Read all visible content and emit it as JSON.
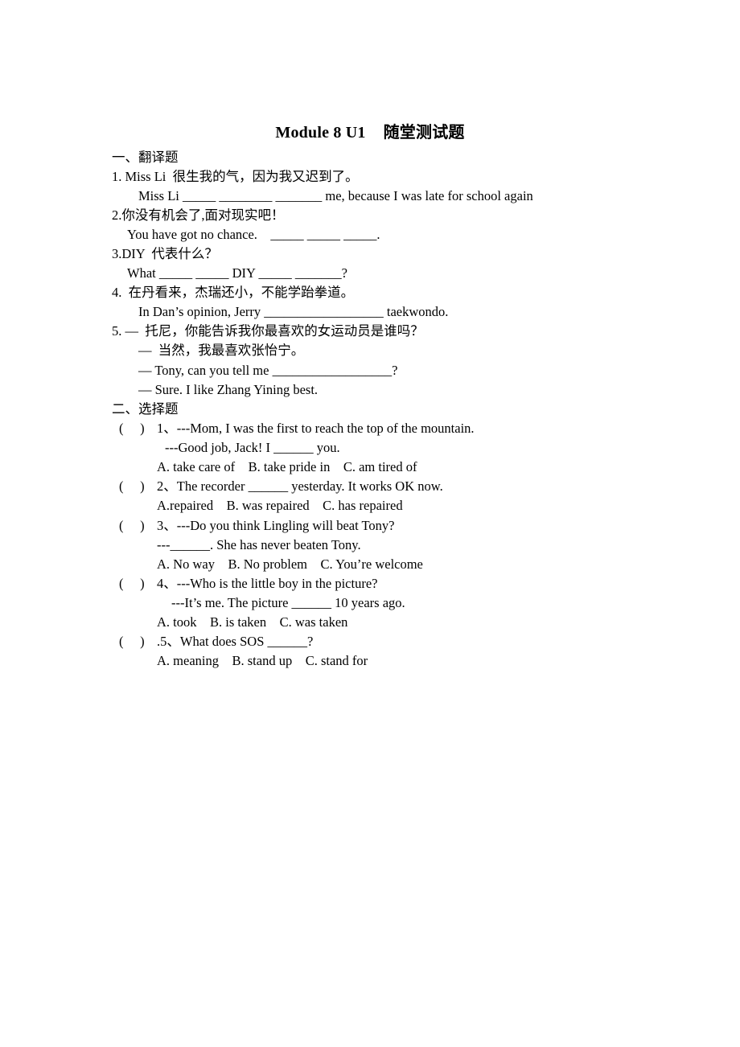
{
  "title": {
    "en": "Module 8 U1",
    "cn": "随堂测试题"
  },
  "section1": {
    "heading": "一、翻译题",
    "questions": [
      {
        "prompt": "1. Miss Li  很生我的气，因为我又迟到了。",
        "answer_lines": [
          "Miss Li _____ ________ _______ me, because I was late for school again"
        ]
      },
      {
        "prompt": "2.你没有机会了,面对现实吧！",
        "answer_lines": [
          "You have got no chance.    _____ _____ _____."
        ]
      },
      {
        "prompt": "3.DIY  代表什么？",
        "answer_lines": [
          "What _____ _____ DIY _____ _______?"
        ]
      },
      {
        "prompt": "4.  在丹看来，杰瑞还小，不能学跆拳道。",
        "answer_lines": [
          "In Dan’s opinion, Jerry __________________ taekwondo."
        ]
      },
      {
        "prompt": "5. —  托尼，你能告诉我你最喜欢的女运动员是谁吗？",
        "answer_lines": [
          "—  当然，我最喜欢张怡宁。",
          "— Tony, can you tell me __________________?",
          "— Sure. I like Zhang Yining best."
        ]
      }
    ]
  },
  "section2": {
    "heading": "二、选择题",
    "questions": [
      {
        "bracket": "(     )",
        "stem": "1、---Mom, I was the first to reach the top of the mountain.",
        "follow": "---Good job, Jack! I ______ you.",
        "options": "A. take care of    B. take pride in    C. am tired of"
      },
      {
        "bracket": "(     )",
        "stem": "2、The recorder ______ yesterday. It works OK now.",
        "follow": "",
        "options": "A.repaired    B. was repaired    C. has repaired"
      },
      {
        "bracket": "(     )",
        "stem": "3、---Do you think Lingling will beat Tony?",
        "follow": "---______. She has never beaten Tony.",
        "options": "A. No way    B. No problem    C. You’re welcome"
      },
      {
        "bracket": "(     )",
        "stem": "4、---Who is the little boy in the picture?",
        "follow": "---It’s me. The picture ______ 10 years ago.",
        "options": "A. took    B. is taken    C. was taken"
      },
      {
        "bracket": "(     )",
        "stem": ".5、What does SOS ______?",
        "follow": "",
        "options": "A. meaning    B. stand up    C. stand for"
      }
    ]
  }
}
